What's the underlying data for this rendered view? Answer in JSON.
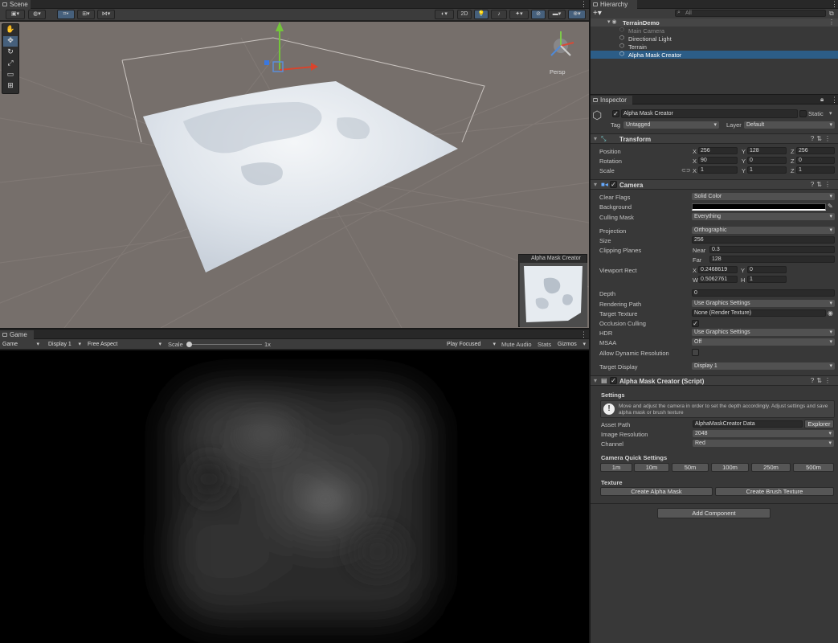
{
  "scene": {
    "tab": "Scene",
    "persp": "Persp",
    "overlay_title": "Alpha Mask Creator",
    "toolbar_2d": "2D"
  },
  "game": {
    "tab": "Game",
    "mode": "Game",
    "display": "Display 1",
    "aspect": "Free Aspect",
    "scale_label": "Scale",
    "scale_value": "1x",
    "play_focused": "Play Focused",
    "mute": "Mute Audio",
    "stats": "Stats",
    "gizmos": "Gizmos"
  },
  "hierarchy": {
    "tab": "Hierarchy",
    "search_placeholder": "All",
    "items": [
      "TerrainDemo",
      "Main Camera",
      "Directional Light",
      "Terrain",
      "Alpha Mask Creator"
    ]
  },
  "inspector": {
    "tab": "Inspector",
    "object_name": "Alpha Mask Creator",
    "static_label": "Static",
    "tag_label": "Tag",
    "tag_value": "Untagged",
    "layer_label": "Layer",
    "layer_value": "Default",
    "transform": {
      "title": "Transform",
      "position_label": "Position",
      "rotation_label": "Rotation",
      "scale_label": "Scale",
      "position": [
        "256",
        "128",
        "256"
      ],
      "rotation": [
        "90",
        "0",
        "0"
      ],
      "scale": [
        "1",
        "1",
        "1"
      ],
      "axes": [
        "X",
        "Y",
        "Z"
      ]
    },
    "camera": {
      "title": "Camera",
      "clear_flags_label": "Clear Flags",
      "clear_flags": "Solid Color",
      "background_label": "Background",
      "culling_mask_label": "Culling Mask",
      "culling_mask": "Everything",
      "projection_label": "Projection",
      "projection": "Orthographic",
      "size_label": "Size",
      "size": "256",
      "clipping_label": "Clipping Planes",
      "near_label": "Near",
      "near": "0.3",
      "far_label": "Far",
      "far": "128",
      "viewport_label": "Viewport Rect",
      "vx_label": "X",
      "vx": "0.2468619",
      "vy_label": "Y",
      "vy": "0",
      "vw_label": "W",
      "vw": "0.5062761",
      "vh_label": "H",
      "vh": "1",
      "depth_label": "Depth",
      "depth": "0",
      "rendering_path_label": "Rendering Path",
      "rendering_path": "Use Graphics Settings",
      "target_texture_label": "Target Texture",
      "target_texture": "None (Render Texture)",
      "occlusion_label": "Occlusion Culling",
      "hdr_label": "HDR",
      "hdr": "Use Graphics Settings",
      "msaa_label": "MSAA",
      "msaa": "Off",
      "dynres_label": "Allow Dynamic Resolution",
      "target_display_label": "Target Display",
      "target_display": "Display 1"
    },
    "script": {
      "title": "Alpha Mask Creator (Script)",
      "settings": "Settings",
      "help": "Move and adjust the camera in order to set the depth accordingly. Adjust settings and save alpha mask or brush texture",
      "asset_path_label": "Asset Path",
      "asset_path": "AlphaMaskCreator Data",
      "explorer": "Explorer",
      "resolution_label": "Image Resolution",
      "resolution": "2048",
      "channel_label": "Channel",
      "channel": "Red",
      "quick_settings": "Camera Quick Settings",
      "quick_buttons": [
        "1m",
        "10m",
        "50m",
        "100m",
        "250m",
        "500m"
      ],
      "texture_label": "Texture",
      "create_alpha": "Create Alpha Mask",
      "create_brush": "Create Brush Texture"
    },
    "add_component": "Add Component"
  },
  "colors": {
    "selection": "#2c5d87",
    "panel": "#383838",
    "scene_bg": "#766f6b"
  }
}
